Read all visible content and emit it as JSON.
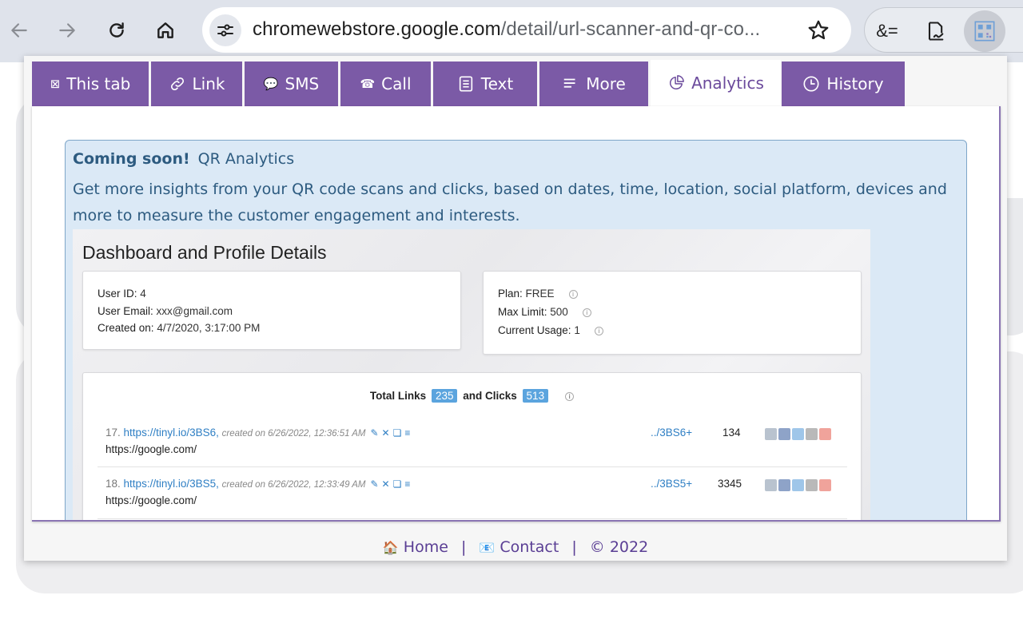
{
  "browser": {
    "url_host": "chromewebstore.google.com",
    "url_path": "/detail/url-scanner-and-qr-co...",
    "ext_amp_label": "&="
  },
  "tabs": [
    {
      "label": "This tab",
      "icon": "tab-icon",
      "active": false
    },
    {
      "label": "Link",
      "icon": "link-icon",
      "active": false
    },
    {
      "label": "SMS",
      "icon": "chat-icon",
      "active": false
    },
    {
      "label": "Call",
      "icon": "phone-icon",
      "active": false
    },
    {
      "label": "Text",
      "icon": "document-icon",
      "active": false
    },
    {
      "label": "More",
      "icon": "menu-icon",
      "active": false
    },
    {
      "label": "Analytics",
      "icon": "pie-chart-icon",
      "active": true
    },
    {
      "label": "History",
      "icon": "clock-icon",
      "active": false
    }
  ],
  "analytics": {
    "coming_soon": "Coming soon!",
    "title": "QR Analytics",
    "description": "Get more insights from your QR code scans and clicks, based on dates, time, location, social platform, devices and more to measure the customer engagement and interests."
  },
  "dashboard": {
    "title": "Dashboard and Profile Details",
    "profile": {
      "user_id_label": "User ID:",
      "user_id": "4",
      "email_label": "User Email:",
      "email": "xxx@gmail.com",
      "created_label": "Created on:",
      "created": "4/7/2020, 3:17:00 PM"
    },
    "plan": {
      "plan_label": "Plan:",
      "plan": "FREE",
      "limit_label": "Max Limit:",
      "limit": "500",
      "usage_label": "Current Usage:",
      "usage": "1"
    },
    "totals": {
      "links_label": "Total Links",
      "links": "235",
      "clicks_label": "and Clicks",
      "clicks": "513"
    },
    "rows": [
      {
        "num": "17.",
        "link": "https://tinyl.io/3BS6,",
        "meta": "created on 6/26/2022, 12:36:51 AM",
        "target": "https://google.com/",
        "short": "../3BS6+",
        "count": "134"
      },
      {
        "num": "18.",
        "link": "https://tinyl.io/3BS5,",
        "meta": "created on 6/26/2022, 12:33:49 AM",
        "target": "https://google.com/",
        "short": "../3BS5+",
        "count": "3345"
      }
    ]
  },
  "footer": {
    "home": "Home",
    "contact": "Contact",
    "copyright": "© 2022"
  }
}
